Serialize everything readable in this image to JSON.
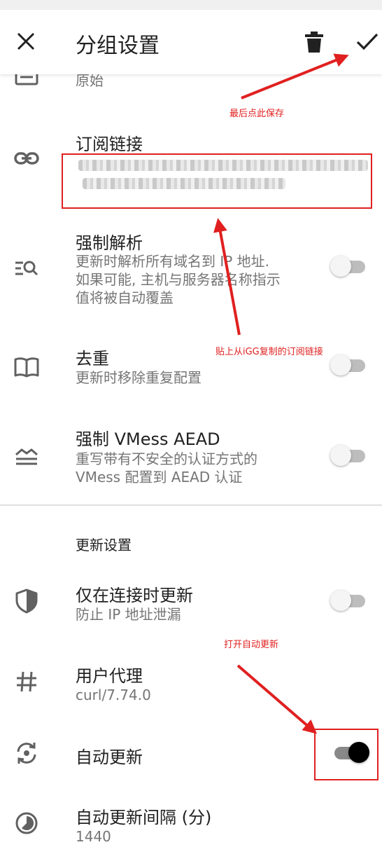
{
  "appbar": {
    "title": "分组设置",
    "close_icon": "close-icon",
    "delete_icon": "trash-icon",
    "save_icon": "check-icon"
  },
  "items": {
    "type_partial": {
      "value": "原始"
    },
    "subscription": {
      "title": "订阅链接"
    },
    "force_resolve": {
      "title": "强制解析",
      "desc_line1": "更新时解析所有域名到 IP 地址.",
      "desc_line2": "如果可能, 主机与服务器名称指示",
      "desc_line3": "值将被自动覆盖",
      "enabled": false
    },
    "dedupe": {
      "title": "去重",
      "desc": "更新时移除重复配置",
      "enabled": false
    },
    "vmess_aead": {
      "title": "强制 VMess AEAD",
      "desc_line1": "重写带有不安全的认证方式的",
      "desc_line2": "VMess 配置到 AEAD 认证",
      "enabled": false
    }
  },
  "update_section": {
    "header": "更新设置",
    "only_when_connected": {
      "title": "仅在连接时更新",
      "desc": "防止 IP 地址泄漏",
      "enabled": false
    },
    "user_agent": {
      "title": "用户代理",
      "value": "curl/7.74.0"
    },
    "auto_update": {
      "title": "自动更新",
      "enabled": true
    },
    "auto_update_interval": {
      "title": "自动更新间隔 (分)",
      "value": "1440"
    }
  },
  "annotations": {
    "save_hint": "最后点此保存",
    "paste_hint": "贴上从iGG复制的订阅链接",
    "auto_update_hint": "打开自动更新",
    "color": "#e02020"
  },
  "colors": {
    "primary_text": "#212121",
    "secondary_text": "#757575",
    "toggle_on_thumb": "#000000"
  }
}
